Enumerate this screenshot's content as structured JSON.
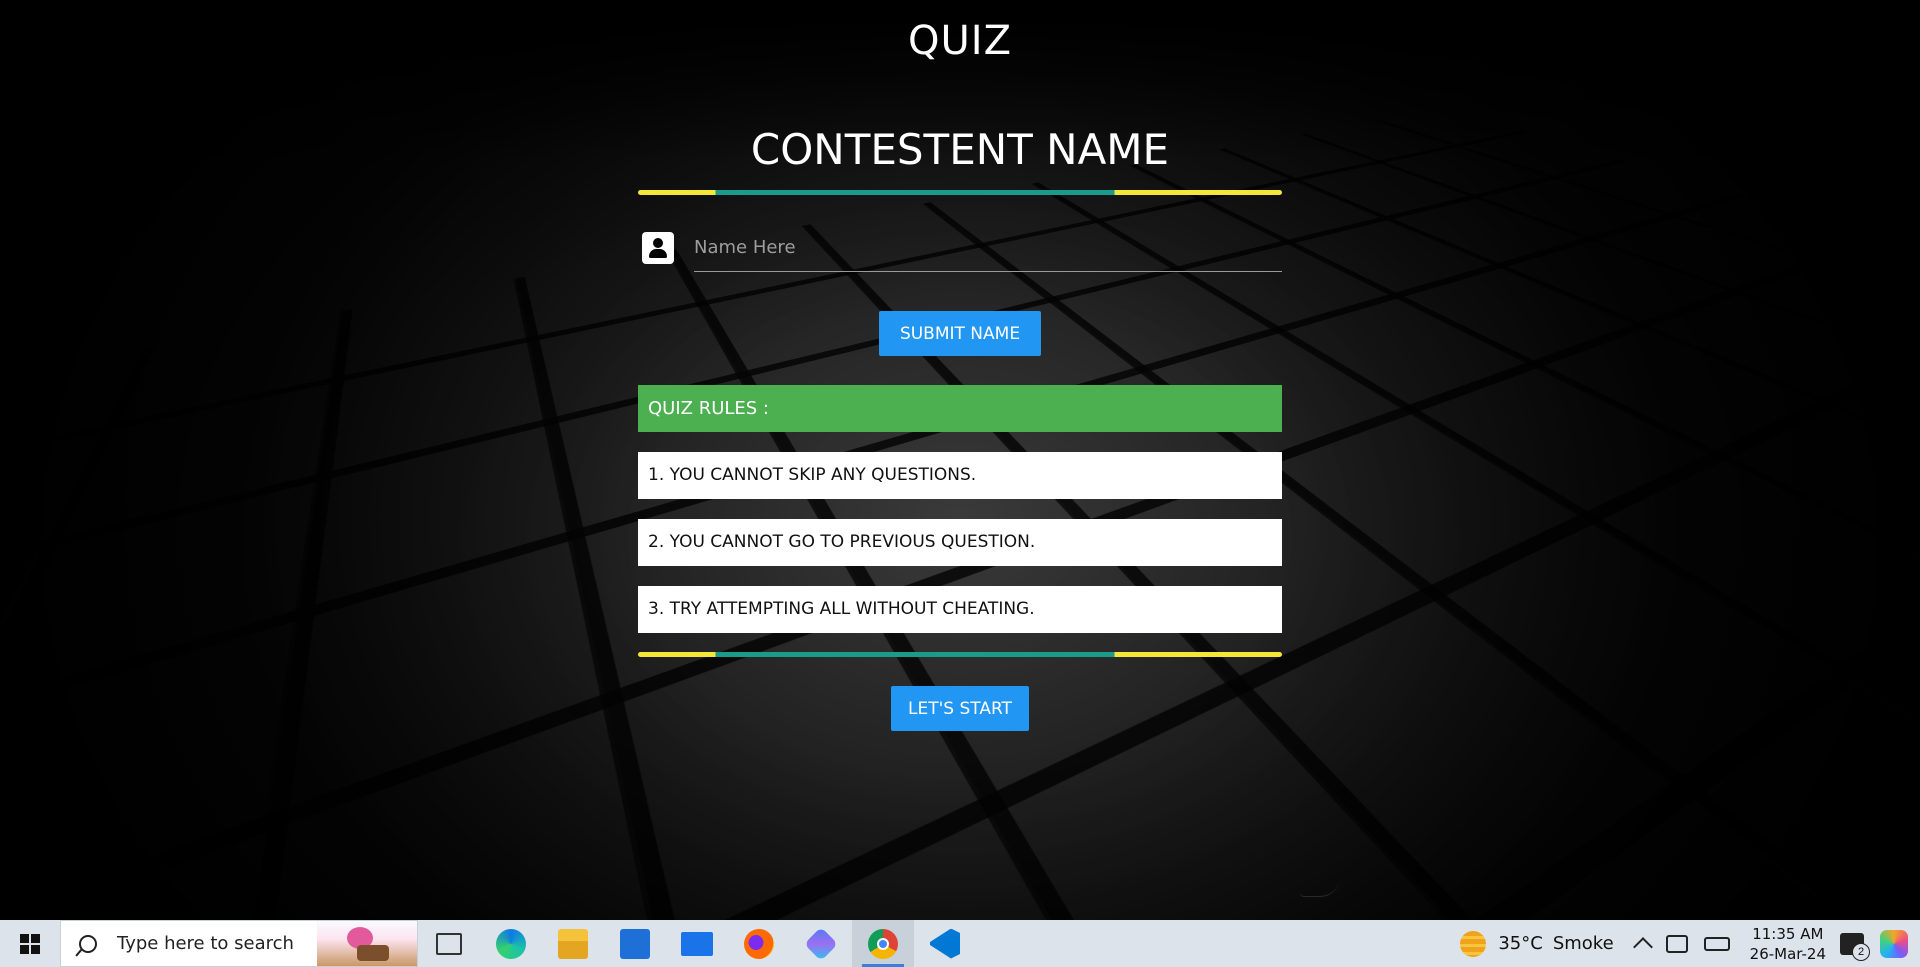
{
  "app": {
    "title": "QUIZ",
    "heading": "CONTESTENT NAME",
    "name_input": {
      "placeholder": "Name Here",
      "value": ""
    },
    "submit_label": "SUBMIT NAME",
    "rules_title": "QUIZ RULES :",
    "rules": [
      "1. YOU CANNOT SKIP ANY QUESTIONS.",
      "2. YOU CANNOT GO TO PREVIOUS QUESTION.",
      "3. TRY ATTEMPTING ALL WITHOUT CHEATING."
    ],
    "start_label": "LET'S START",
    "colors": {
      "button": "#2196f3",
      "rules_header": "#4caf50",
      "divider_edge": "#f5e63a",
      "divider_center": "#1b9b8a"
    }
  },
  "taskbar": {
    "search_placeholder": "Type here to search",
    "pinned_icons": [
      "task-view-icon",
      "edge-icon",
      "file-explorer-icon",
      "store-icon",
      "mail-icon",
      "firefox-icon",
      "copilot-app-icon",
      "chrome-icon",
      "vscode-icon"
    ],
    "active_app": "chrome-icon",
    "weather": {
      "temperature": "35°C",
      "condition": "Smoke"
    },
    "clock": {
      "time": "11:35 AM",
      "date": "26-Mar-24"
    },
    "notification_count": "2"
  }
}
